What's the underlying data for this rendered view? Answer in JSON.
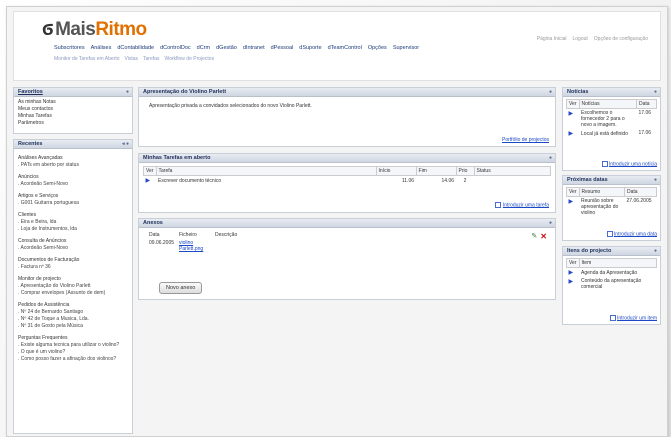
{
  "app": {
    "logo_prefix": "Mais",
    "logo_accent": "Ritmo"
  },
  "topnav": [
    "Subscritores",
    "Análises",
    "dContabilidade",
    "dControlDoc",
    "dCrm",
    "dGestão",
    "dIntranet",
    "dPessoal",
    "dSuporte",
    "dTeamControl",
    "Opções",
    "Supervisor"
  ],
  "subnav": [
    "Monitor de Tarefas em Aberto",
    "Vistas",
    "Tarefas",
    "Workflow de Projectos"
  ],
  "toplinks": [
    "Página Inicial",
    "Logout",
    "Opções de configuração"
  ],
  "favorites": {
    "title": "Favoritos",
    "items": [
      "As minhas Notas",
      "Meus contactos",
      "Minhas Tarefas",
      "Parâmetros"
    ]
  },
  "recent": {
    "title": "Recentes",
    "groups": [
      {
        "title": "Análises Avançadas",
        "items": [
          ". PATs em aberto por status"
        ]
      },
      {
        "title": "Anúncios",
        "items": [
          ". Acordeão Semi-Novo"
        ]
      },
      {
        "title": "Artigos e Serviços",
        "items": [
          ". G001 Guitarra portuguesa"
        ]
      },
      {
        "title": "Clientes",
        "items": [
          ". Eira e Beira, lda",
          ". Loja de Instrumentos, lda"
        ]
      },
      {
        "title": "Consulta de Anúncios",
        "items": [
          ". Acordeão Semi-Novo"
        ]
      },
      {
        "title": "Documentos de Facturação",
        "items": [
          ". Factura nº 36"
        ]
      },
      {
        "title": "Monitor de projecto",
        "items": [
          ". Apresentação do Violino Parlett",
          ". Comprar envelopes (Assunto de dem)"
        ]
      },
      {
        "title": "Pedidos de Assistência",
        "items": [
          ". Nº 24 de Bernardo Santiago",
          ". Nº 42 de Toque a Musica, Lda.",
          ". Nº 31 de Gosto pela Música"
        ]
      },
      {
        "title": "Perguntas Frequentes",
        "items": [
          ". Existe alguma tecnica para utilizar o violino?",
          ". O que é um violino?",
          ". Como posso fazer a afinação dos violinos?"
        ]
      }
    ]
  },
  "presentation": {
    "title": "Apresentação do Violino Parlett",
    "body": "Apresentação privada a convidados selecionados do novo Violino Parlett.",
    "link": "Portfólio de projectos"
  },
  "tasks": {
    "title": "Minhas Tarefas em aberto",
    "headers": [
      "Ver",
      "Tarefa",
      "Início",
      "Fim",
      "Prio",
      "Status"
    ],
    "rows": [
      {
        "tarefa": "Escrever documento técnico",
        "inicio": "11.06",
        "fim": "14.06",
        "prio": "2",
        "status": ""
      }
    ],
    "link": "Introduzir uma tarefa"
  },
  "attachments": {
    "title": "Anexos",
    "headers": [
      "Data",
      "Ficheiro",
      "Descrição"
    ],
    "rows": [
      {
        "data": "09.06.2005",
        "ficheiro": "violino Parlett.png",
        "descricao": ""
      }
    ],
    "button": "Novo anexo"
  },
  "news": {
    "title": "Notícias",
    "headers": [
      "Ver",
      "Notícias",
      "Data"
    ],
    "rows": [
      {
        "texto": "Escolhemos o fornecedor 2 para o novo a imagem.",
        "data": "17.06"
      },
      {
        "texto": "Local já está definido",
        "data": "17.06"
      }
    ],
    "link": "Introduzir uma notícia"
  },
  "dates": {
    "title": "Próximas datas",
    "headers": [
      "Ver",
      "Resumo",
      "Data"
    ],
    "rows": [
      {
        "resumo": "Reunião sobre apresentação do violino",
        "data": "27.06.2005"
      }
    ],
    "link": "Introduzir uma data"
  },
  "project": {
    "title": "Itens do projecto",
    "headers": [
      "Ver",
      "Item"
    ],
    "rows": [
      {
        "item": "Agenda da Apresentação"
      },
      {
        "item": "Conteúdo da apresentação comercial"
      }
    ],
    "link": "Introduzir um item"
  }
}
